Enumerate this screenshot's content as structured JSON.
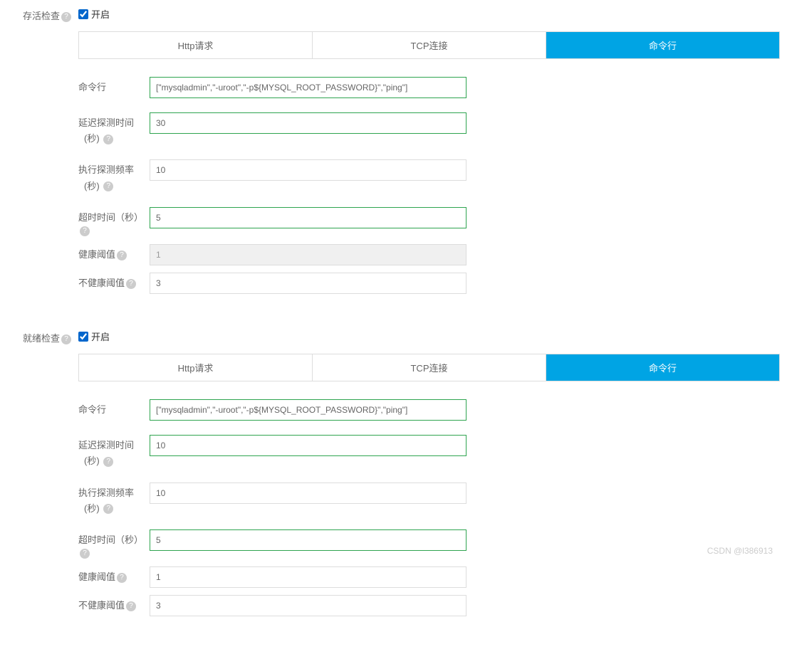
{
  "liveness": {
    "title": "存活检查",
    "enable_label": "开启",
    "enabled": true,
    "tabs": [
      "Http请求",
      "TCP连接",
      "命令行"
    ],
    "active_tab": 2,
    "fields": {
      "command": {
        "label": "命令行",
        "value": "[\"mysqladmin\",\"-uroot\",\"-p${MYSQL_ROOT_PASSWORD}\",\"ping\"]",
        "highlight": true
      },
      "delay": {
        "label": "延迟探测时间",
        "sub": "(秒)",
        "value": "30",
        "highlight": true
      },
      "period": {
        "label": "执行探测频率",
        "sub": "(秒)",
        "value": "10",
        "highlight": false
      },
      "timeout": {
        "label": "超时时间（秒）",
        "value": "5",
        "highlight": true
      },
      "success": {
        "label": "健康阈值",
        "value": "1",
        "disabled": true
      },
      "failure": {
        "label": "不健康阈值",
        "value": "3",
        "highlight": false
      }
    }
  },
  "readiness": {
    "title": "就绪检查",
    "enable_label": "开启",
    "enabled": true,
    "tabs": [
      "Http请求",
      "TCP连接",
      "命令行"
    ],
    "active_tab": 2,
    "fields": {
      "command": {
        "label": "命令行",
        "value": "[\"mysqladmin\",\"-uroot\",\"-p${MYSQL_ROOT_PASSWORD}\",\"ping\"]",
        "highlight": true
      },
      "delay": {
        "label": "延迟探测时间",
        "sub": "(秒)",
        "value": "10",
        "highlight": true
      },
      "period": {
        "label": "执行探测频率",
        "sub": "(秒)",
        "value": "10",
        "highlight": false
      },
      "timeout": {
        "label": "超时时间（秒）",
        "value": "5",
        "highlight": true
      },
      "success": {
        "label": "健康阈值",
        "value": "1",
        "highlight": false
      },
      "failure": {
        "label": "不健康阈值",
        "value": "3",
        "highlight": false
      }
    }
  },
  "watermark": "CSDN @l386913"
}
